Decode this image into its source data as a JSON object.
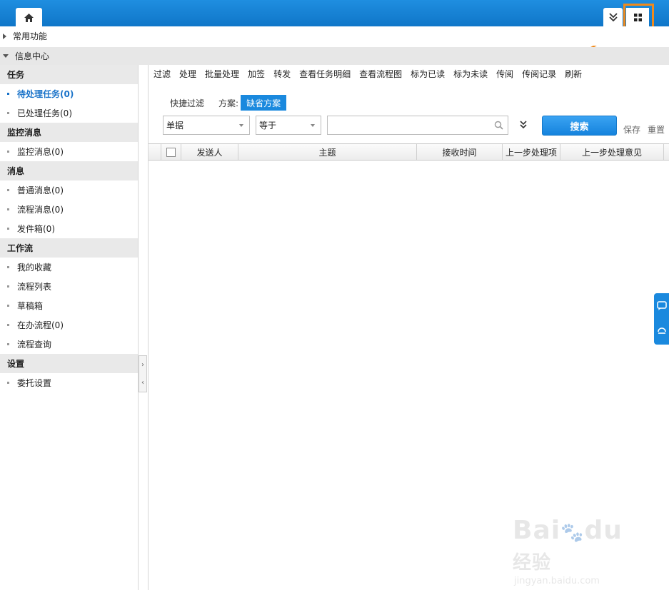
{
  "topbar": {
    "tabs": [
      {
        "icon": "home-icon"
      },
      {
        "icon": "double-chevron-down-icon"
      },
      {
        "icon": "grid-icon"
      }
    ],
    "highlight_color": "#f08a1c",
    "accent_color": "#1a89de"
  },
  "sections": {
    "common": "常用功能",
    "info_center": "信息中心"
  },
  "sidebar": {
    "groups": [
      {
        "title": "任务",
        "items": [
          "待处理任务(0)",
          "已处理任务(0)"
        ]
      },
      {
        "title": "监控消息",
        "items": [
          "监控消息(0)"
        ]
      },
      {
        "title": "消息",
        "items": [
          "普通消息(0)",
          "流程消息(0)",
          "发件箱(0)"
        ]
      },
      {
        "title": "工作流",
        "items": [
          "我的收藏",
          "流程列表",
          "草稿箱",
          "在办流程(0)",
          "流程查询"
        ]
      },
      {
        "title": "设置",
        "items": [
          "委托设置"
        ]
      }
    ],
    "active_item": "待处理任务(0)"
  },
  "toolbar": {
    "items": [
      "过滤",
      "处理",
      "批量处理",
      "加签",
      "转发",
      "查看任务明细",
      "查看流程图",
      "标为已读",
      "标为未读",
      "传阅",
      "传阅记录",
      "刷新"
    ]
  },
  "filter": {
    "quick_filter_label": "快捷过滤",
    "scheme_label": "方案:",
    "scheme_button": "缺省方案",
    "field_select": "单据",
    "operator_select": "等于",
    "search_value": "",
    "search_button": "搜索",
    "save_link": "保存",
    "reset_link": "重置"
  },
  "grid": {
    "columns": [
      "",
      "发送人",
      "主题",
      "接收时间",
      "上一步处理项",
      "上一步处理意见"
    ],
    "rows": []
  },
  "watermark": {
    "logo_text": "Bai",
    "logo_text2": "du",
    "logo_cn": "经验",
    "url": "jingyan.baidu.com"
  }
}
